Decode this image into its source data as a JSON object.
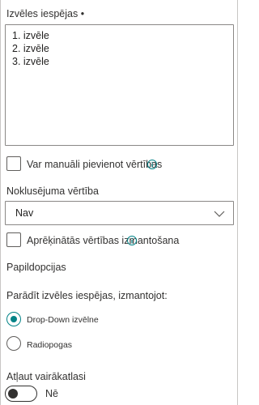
{
  "choices": {
    "label": "Izvēles iespējas •",
    "lines": [
      "1. izvēle",
      "2. izvēle",
      "3. izvēle"
    ]
  },
  "manual_values": {
    "label": "Var manuāli pievienot vērtības",
    "checked": false
  },
  "default_value": {
    "label": "Noklusējuma vērtība",
    "selected": "Nav"
  },
  "calculated": {
    "label": "Aprēķinātās vērtības izmantošana",
    "checked": false
  },
  "additional": {
    "heading": "Papildopcijas"
  },
  "display_as": {
    "label": "Parādīt izvēles iespējas, izmantojot:",
    "options": [
      {
        "label": "Drop-Down izvēlne",
        "selected": true
      },
      {
        "label": "Radiopogas",
        "selected": false
      }
    ]
  },
  "multi_select": {
    "label": "Atļaut vairākatlasi",
    "state_label": "Nē",
    "on": false
  },
  "colors": {
    "accent": "#038387",
    "border": "#8a8886",
    "text": "#323130"
  }
}
